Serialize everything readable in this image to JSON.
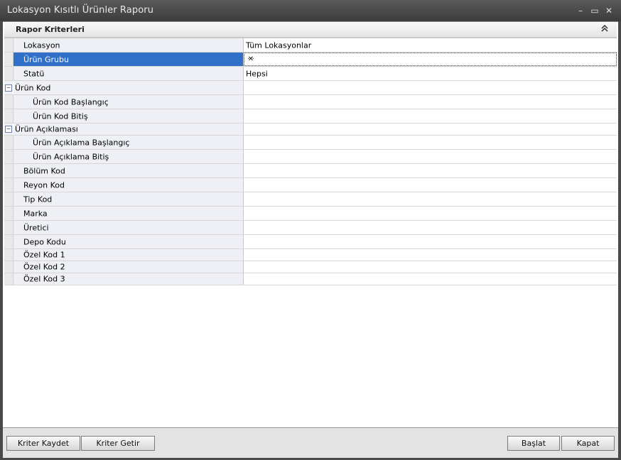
{
  "window": {
    "title": "Lokasyon Kısıtlı Ürünler Raporu",
    "controls": {
      "minimize": "–",
      "maximize": "▭",
      "close": "✕"
    }
  },
  "group": {
    "title": "Rapor Kriterleri",
    "collapse_glyph": "⌃"
  },
  "rows": [
    {
      "label": "Lokasyon",
      "value": "Tüm Lokasyonlar"
    },
    {
      "label": "Ürün Grubu",
      "value": ""
    },
    {
      "label": "Statü",
      "value": "Hepsi"
    },
    {
      "label": "Ürün Kod",
      "value": ""
    },
    {
      "label": "Ürün Kod Başlangıç",
      "value": ""
    },
    {
      "label": "Ürün Kod Bitiş",
      "value": ""
    },
    {
      "label": "Ürün Açıklaması",
      "value": ""
    },
    {
      "label": "Ürün Açıklama Başlangıç",
      "value": ""
    },
    {
      "label": "Ürün Açıklama Bitiş",
      "value": ""
    },
    {
      "label": "Bölüm Kod",
      "value": ""
    },
    {
      "label": "Reyon Kod",
      "value": ""
    },
    {
      "label": "Tip Kod",
      "value": ""
    },
    {
      "label": "Marka",
      "value": ""
    },
    {
      "label": "Üretici",
      "value": ""
    },
    {
      "label": "Depo Kodu",
      "value": ""
    },
    {
      "label": "Özel Kod 1",
      "value": ""
    },
    {
      "label": "Özel Kod 2",
      "value": ""
    },
    {
      "label": "Özel Kod 3",
      "value": ""
    }
  ],
  "editor_buttons": {
    "ellipsis": "···",
    "clear": "✕"
  },
  "tree_toggle": "−",
  "footer": {
    "save_criteria": "Kriter Kaydet",
    "load_criteria": "Kriter Getir",
    "start": "Başlat",
    "close": "Kapat"
  },
  "colors": {
    "selection": "#3170c8",
    "titlebar": "#4a4a4a"
  }
}
